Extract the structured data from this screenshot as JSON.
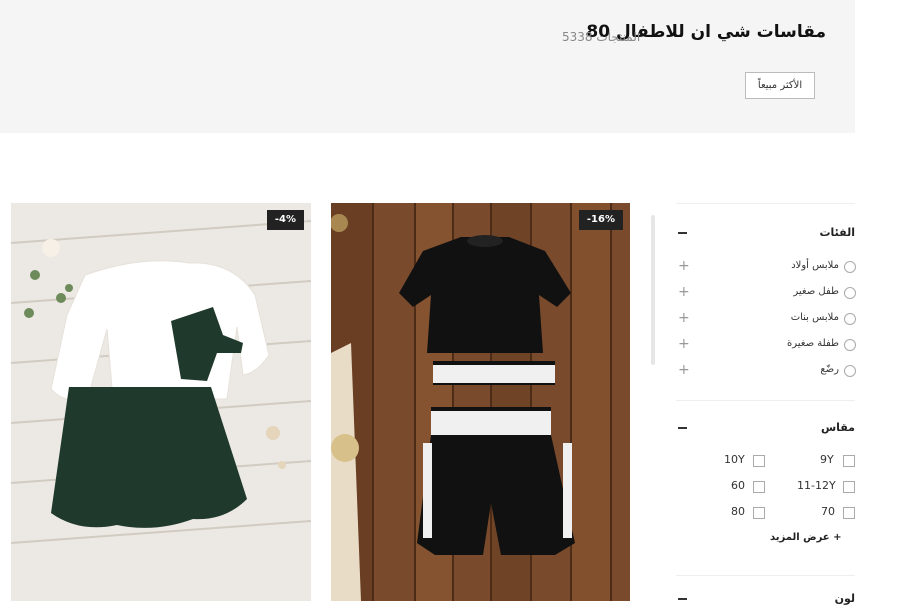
{
  "header": {
    "title": "مقاسات شي ان للاطفال 80",
    "product_count": "5338 المنتجات",
    "sort_label": "الأكثر مبيعاً"
  },
  "products": [
    {
      "discount": "-16%",
      "image_icon": "black-love-outfit-photo"
    },
    {
      "discount": "-4%",
      "image_icon": "white-top-green-dress-photo"
    }
  ],
  "filters": {
    "categories": {
      "title": "الفئات",
      "items": [
        "ملابس أولاد",
        "طفل صغير",
        "ملابس بنات",
        "طفلة صغيرة",
        "رضّع"
      ]
    },
    "size": {
      "title": "مقاس",
      "options": [
        "9Y",
        "10Y",
        "11-12Y",
        "60",
        "70",
        "80"
      ],
      "view_more": "+ عرض المزيد"
    },
    "color": {
      "title": "لون"
    }
  },
  "colors": {
    "header_bg": "#f5f5f5",
    "badge_bg": "#222222"
  }
}
